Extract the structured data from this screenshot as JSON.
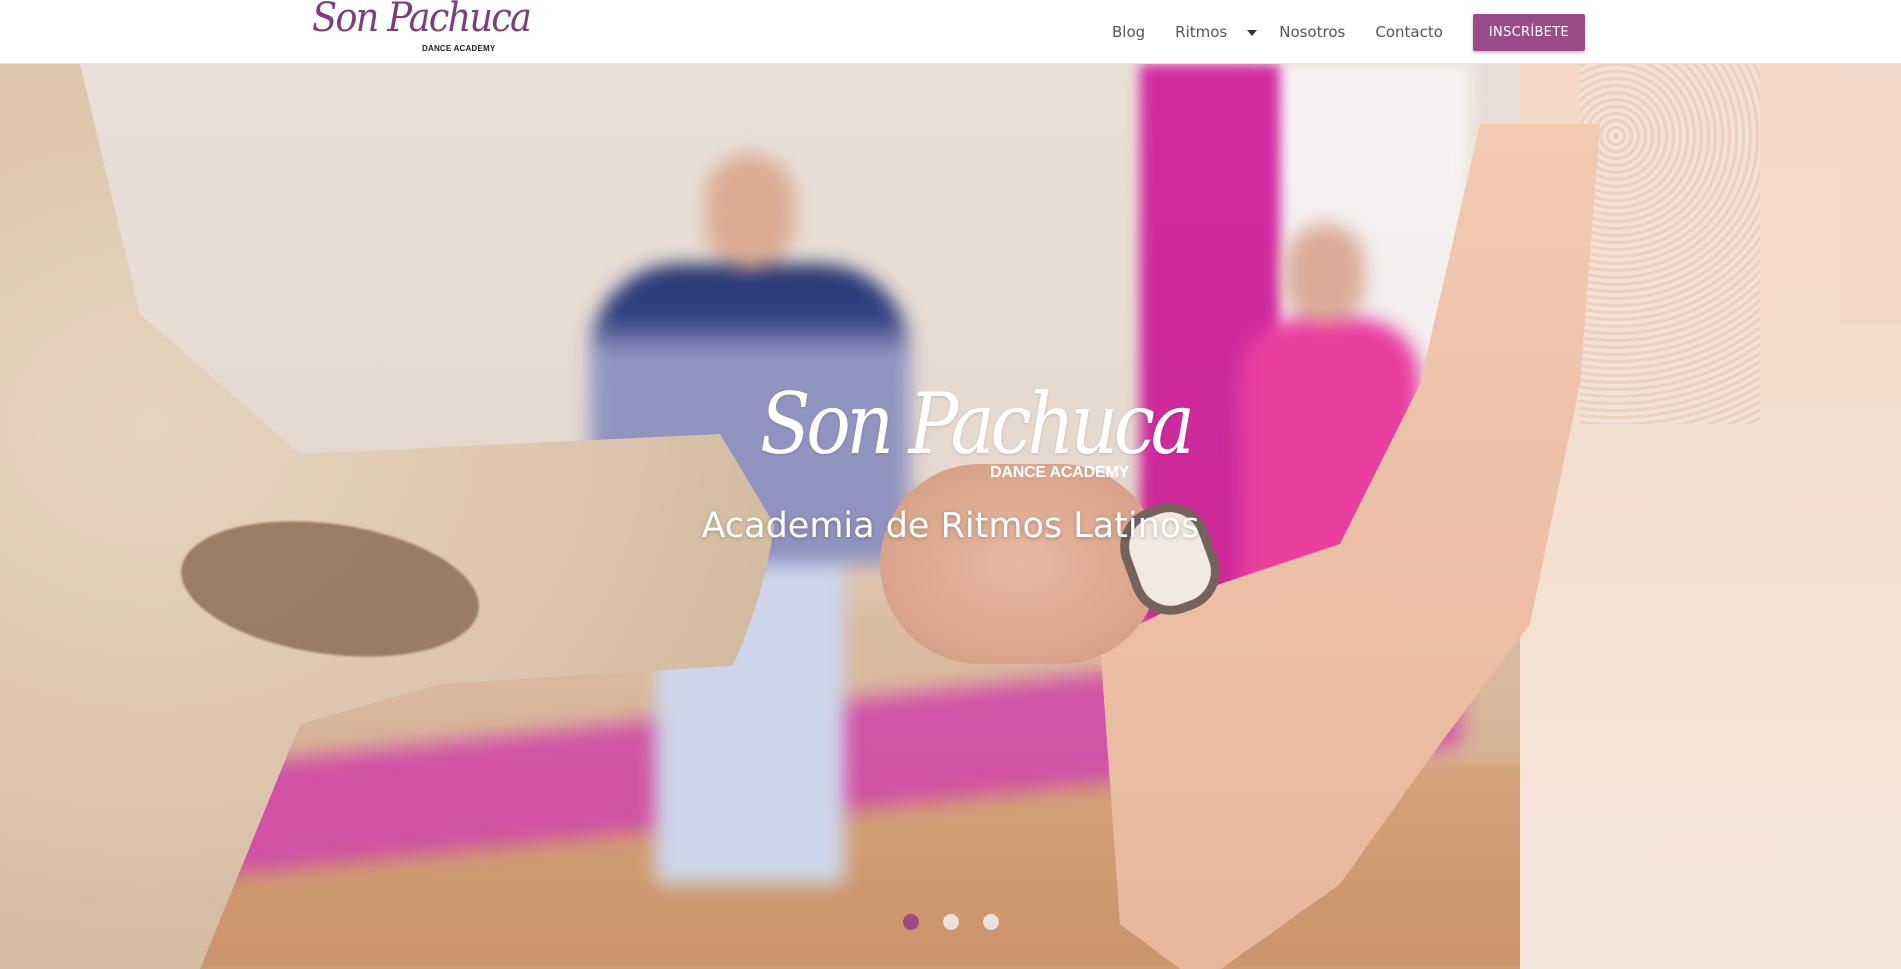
{
  "header": {
    "logo": {
      "script_text": "Son Pachuca",
      "sub_text": "DANCE ACADEMY"
    },
    "nav": {
      "blog": "Blog",
      "ritmos": "Ritmos",
      "nosotros": "Nosotros",
      "contacto": "Contacto",
      "cta": "INSCRÍBETE"
    }
  },
  "hero": {
    "logo_script": "Son Pachuca",
    "logo_sub": "DANCE ACADEMY",
    "subtitle": "Academia de Ritmos Latinos",
    "slides_count": 3,
    "active_slide": 1
  },
  "colors": {
    "brand": "#9b4b87",
    "nav_text": "#555555",
    "logo_purple": "#7d3e7d"
  },
  "icons": {
    "dropdown": "caret-down-icon"
  }
}
